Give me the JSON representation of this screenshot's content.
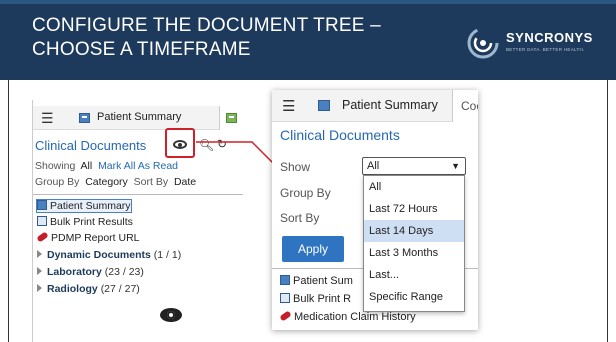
{
  "slide": {
    "title_line1": "CONFIGURE THE DOCUMENT TREE –",
    "title_line2": "CHOOSE A TIMEFRAME",
    "logo_name": "SYNCRONYS",
    "logo_tagline": "BETTER DATA. BETTER HEALTH."
  },
  "left_panel": {
    "tab_label": "Patient Summary",
    "section_title": "Clinical Documents",
    "showing_label": "Showing",
    "showing_value": "All",
    "mark_all_link": "Mark All As Read",
    "group_by_label": "Group By",
    "group_by_value": "Category",
    "sort_by_label": "Sort By",
    "sort_by_value": "Date",
    "items": [
      {
        "label": "Patient Summary"
      },
      {
        "label": "Bulk Print Results"
      },
      {
        "label": "PDMP Report URL"
      }
    ],
    "folders": [
      {
        "name": "Dynamic Documents",
        "count": "(1 / 1)"
      },
      {
        "name": "Laboratory",
        "count": "(23 / 23)"
      },
      {
        "name": "Radiology",
        "count": "(27 / 27)"
      }
    ]
  },
  "right_panel": {
    "tab_label": "Patient Summary",
    "tab2_label": "Coc",
    "section_title": "Clinical Documents",
    "show_label": "Show",
    "show_value": "All",
    "group_by_label": "Group By",
    "sort_by_label": "Sort By",
    "apply_label": "Apply",
    "items": [
      {
        "label": "Patient Sum"
      },
      {
        "label": "Bulk Print R"
      },
      {
        "label": "Medication Claim History"
      }
    ],
    "dropdown_options": [
      "All",
      "Last 72 Hours",
      "Last 14 Days",
      "Last 3 Months",
      "Last...",
      "Specific Range"
    ],
    "highlighted_option": "Last 14 Days"
  },
  "colors": {
    "header": "#1d3a5c",
    "link": "#2569b3",
    "apply": "#2f74c0",
    "callout": "#d0202a"
  }
}
